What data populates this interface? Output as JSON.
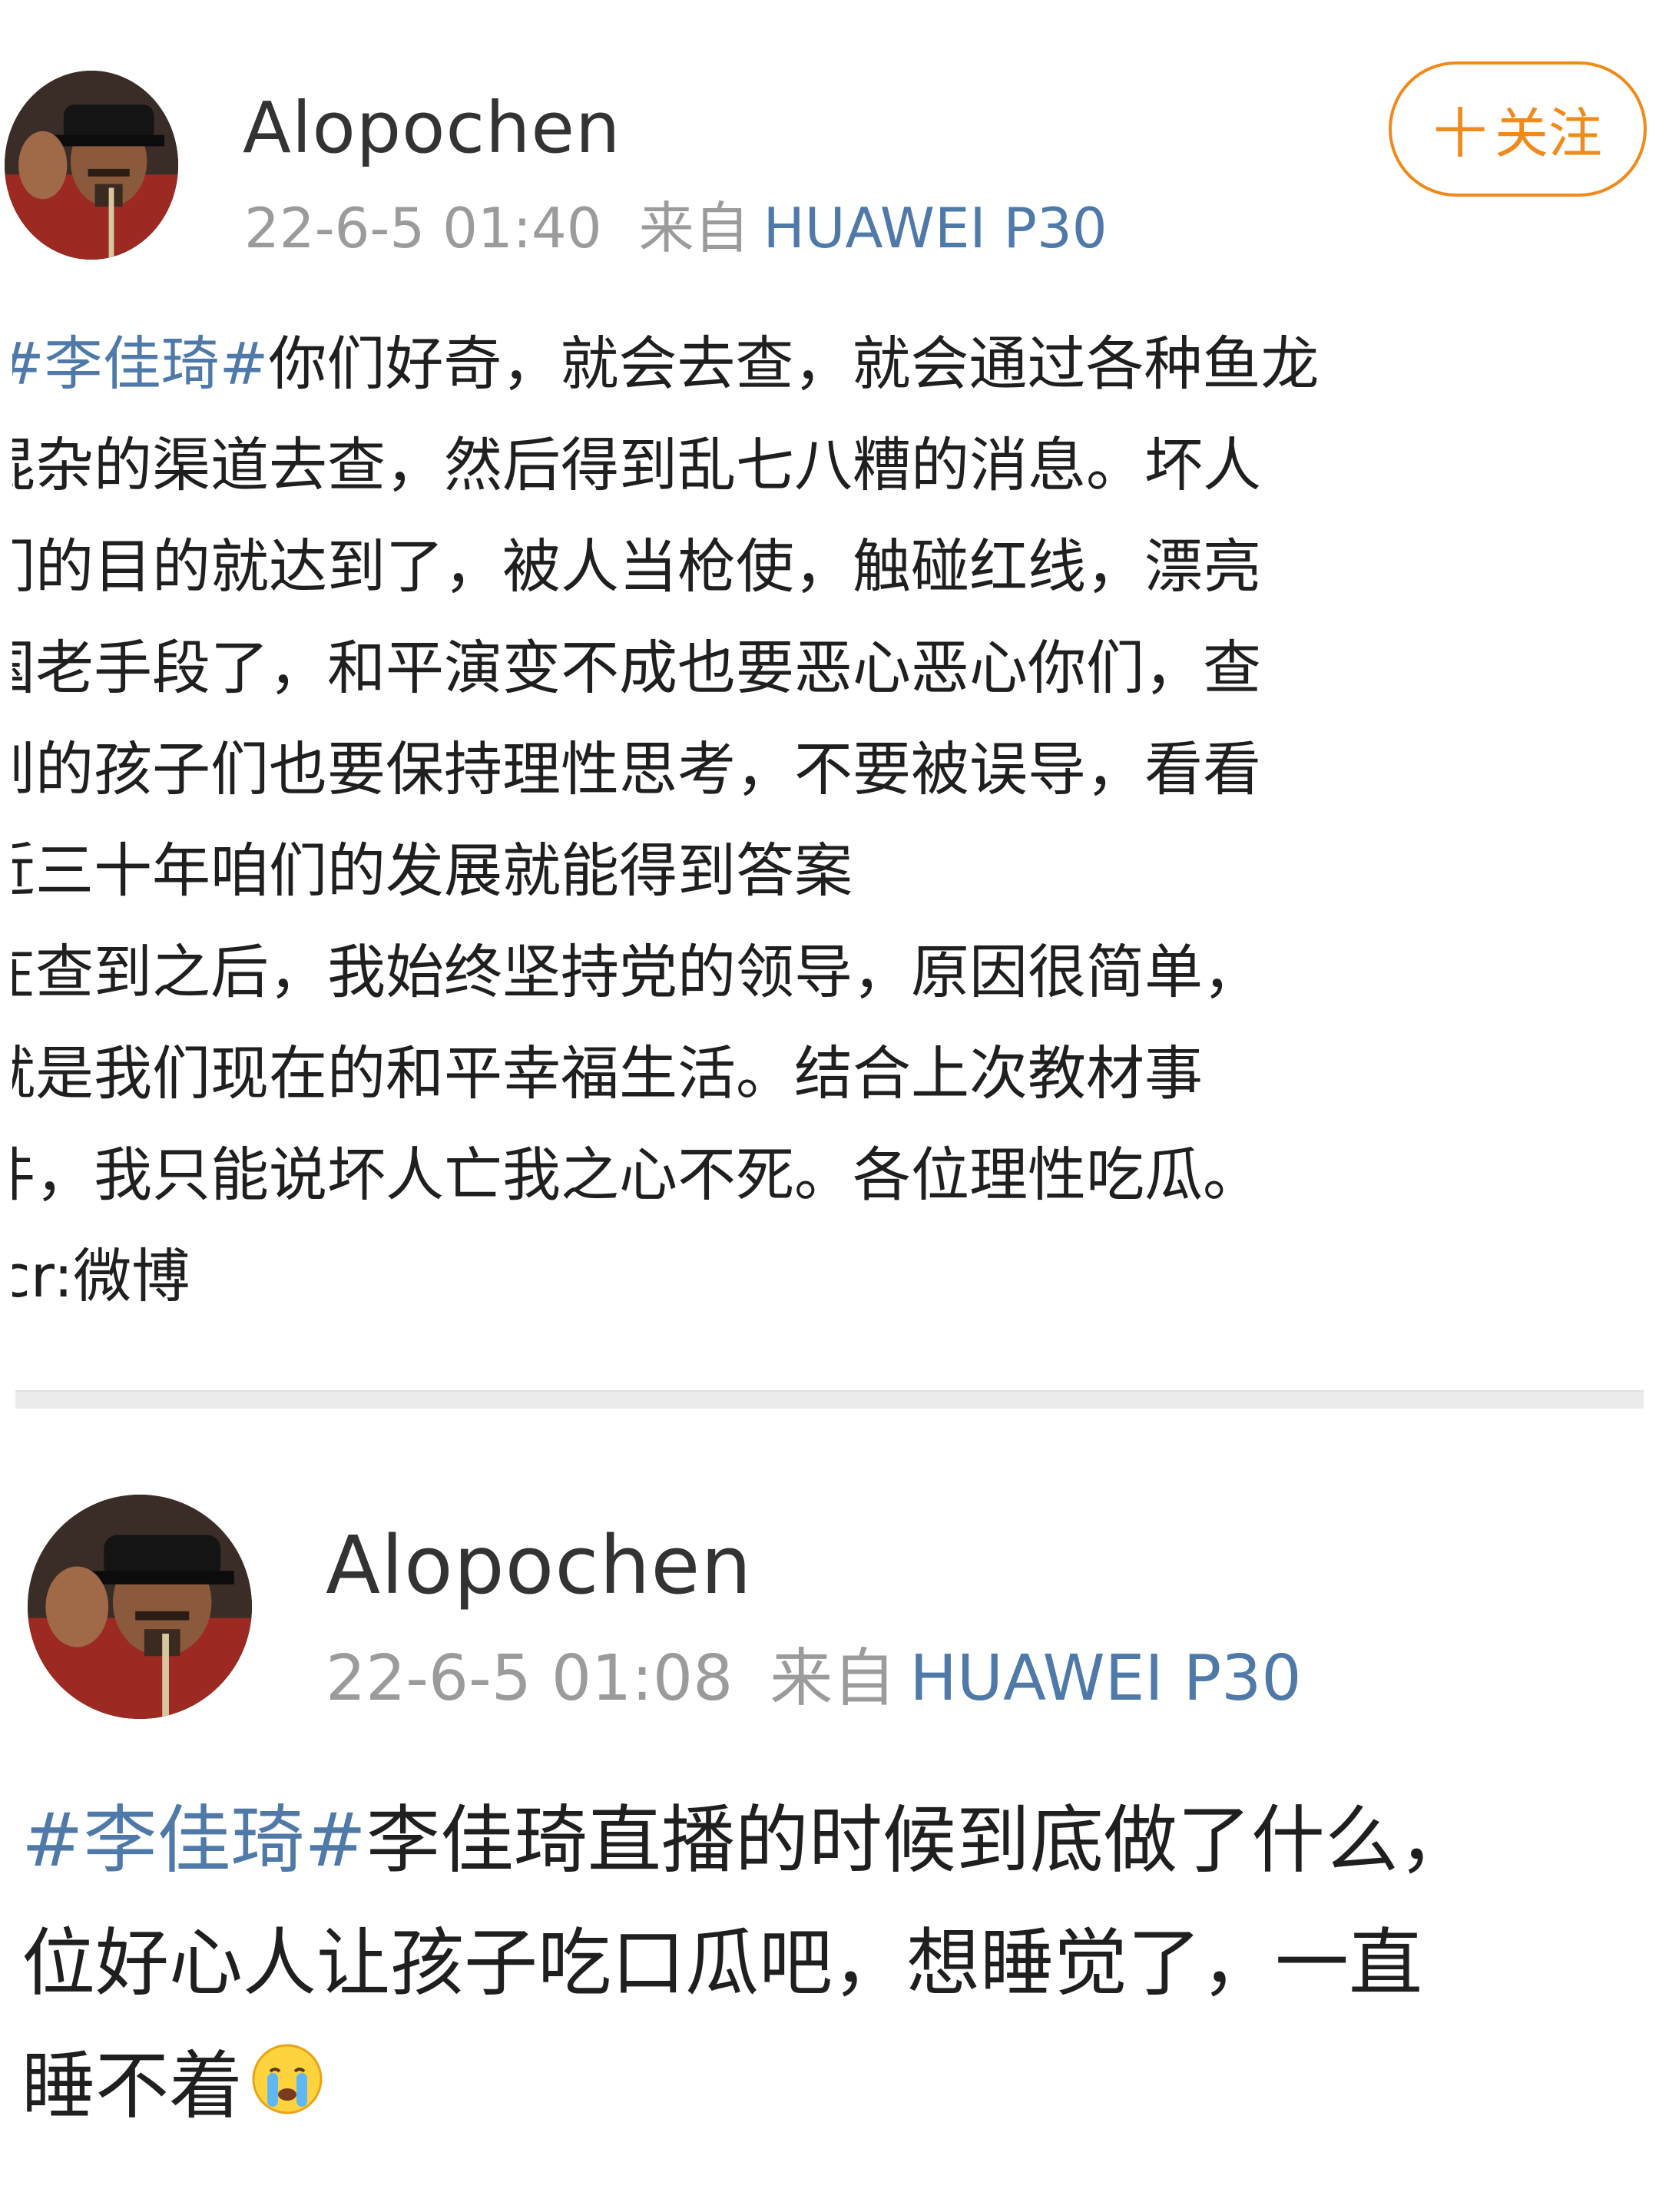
{
  "colors": {
    "accent_orange": "#ef8a1b",
    "link_blue": "#4f79a8",
    "meta_gray": "#9b9b9b",
    "text": "#1f1f1f"
  },
  "posts": [
    {
      "username": "Alopochen",
      "timestamp": "22-6-5 01:40",
      "source_label": "来自",
      "device": "HUAWEI P30",
      "follow_button": {
        "icon": "plus-icon",
        "plus": "十",
        "label": "关注"
      },
      "lines": [
        {
          "tag": "#李佳琦#",
          "text": "你们好奇，就会去查，就会通过各种鱼龙"
        },
        {
          "text": "混杂的渠道去查，然后得到乱七八糟的消息。坏人"
        },
        {
          "text": "们的目的就达到了，被人当枪使，触碰红线，漂亮"
        },
        {
          "text": "国老手段了，和平演变不成也要恶心恶心你们，查"
        },
        {
          "text": "到的孩子们也要保持理性思考，不要被误导，看看"
        },
        {
          "text": "近三十年咱们的发展就能得到答案"
        },
        {
          "text": "在查到之后，我始终坚持党的领导，原因很简单，"
        },
        {
          "text": "就是我们现在的和平幸福生活。结合上次教材事"
        },
        {
          "text": "件，我只能说坏人亡我之心不死。各位理性吃瓜。"
        },
        {
          "text": "cr:微博"
        }
      ]
    },
    {
      "username": "Alopochen",
      "timestamp": "22-6-5 01:08",
      "source_label": "来自",
      "device": "HUAWEI P30",
      "lines": [
        {
          "tag": "#李佳琦#",
          "text": "李佳琦直播的时候到底做了什么，"
        },
        {
          "text": "位好心人让孩子吃口瓜吧，想睡觉了，一直"
        },
        {
          "text": "睡不着",
          "emoji": "crying-face-icon"
        }
      ]
    }
  ]
}
